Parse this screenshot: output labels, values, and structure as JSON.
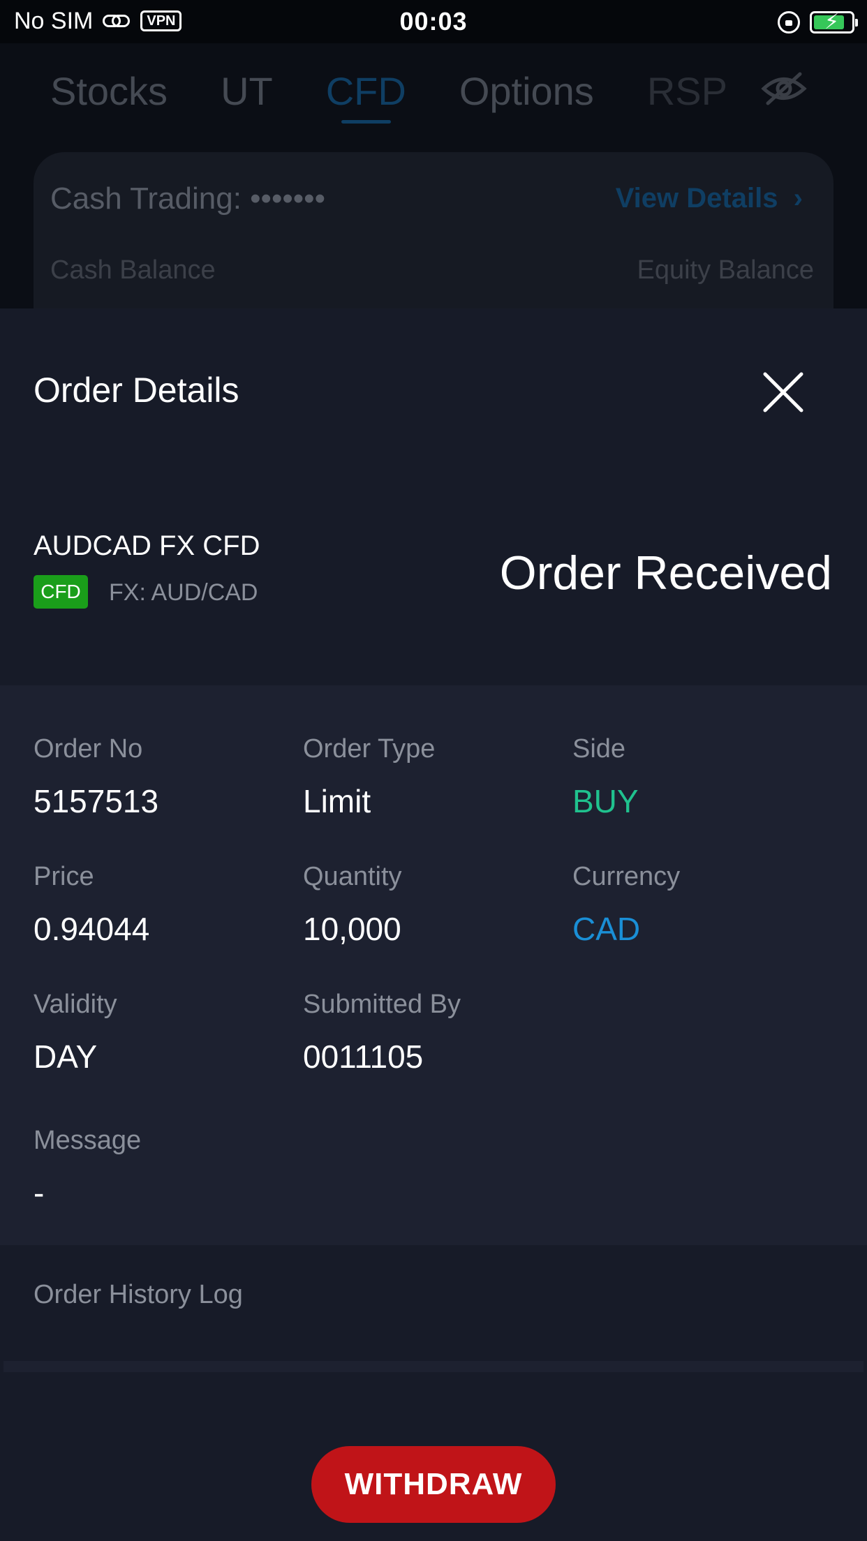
{
  "status_bar": {
    "carrier": "No SIM",
    "vpn": "VPN",
    "time": "00:03"
  },
  "background": {
    "tabs": [
      "Stocks",
      "UT",
      "CFD",
      "Options",
      "RSP"
    ],
    "active_tab": "CFD",
    "account_card": {
      "title": "Cash Trading: •••••••",
      "view_details": "View Details",
      "cash_balance_label": "Cash Balance",
      "equity_balance_label": "Equity Balance"
    }
  },
  "sheet": {
    "title": "Order Details",
    "symbol_name": "AUDCAD FX CFD",
    "badge": "CFD",
    "symbol_sub": "FX: AUD/CAD",
    "status": "Order Received",
    "fields": {
      "order_no": {
        "label": "Order No",
        "value": "5157513"
      },
      "order_type": {
        "label": "Order Type",
        "value": "Limit"
      },
      "side": {
        "label": "Side",
        "value": "BUY"
      },
      "price": {
        "label": "Price",
        "value": "0.94044"
      },
      "quantity": {
        "label": "Quantity",
        "value": "10,000"
      },
      "currency": {
        "label": "Currency",
        "value": "CAD"
      },
      "validity": {
        "label": "Validity",
        "value": "DAY"
      },
      "submitted_by": {
        "label": "Submitted By",
        "value": "0011105"
      },
      "message": {
        "label": "Message",
        "value": "-"
      }
    },
    "history_label": "Order History Log",
    "withdraw_label": "WITHDRAW"
  },
  "colors": {
    "background": "#0b0e15",
    "sheet": "#171b28",
    "details_panel": "#1d2130",
    "buy_green": "#20c28e",
    "currency_blue": "#1a8fd6",
    "cfd_badge_green": "#1a9e1a",
    "withdraw_red": "#c01418"
  },
  "icons": [
    "link-icon",
    "orientation-lock-icon",
    "battery-charging-icon",
    "eye-off-icon",
    "chevron-right-icon",
    "close-icon"
  ]
}
